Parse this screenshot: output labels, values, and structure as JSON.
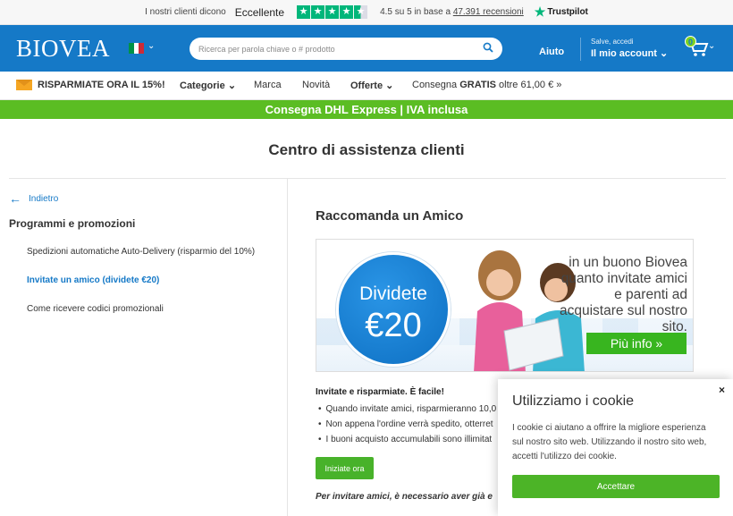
{
  "trustbar": {
    "intro": "I nostri clienti dicono",
    "rating_word": "Eccellente",
    "stars": 4.5,
    "score_text": "4.5 su 5 in base a",
    "reviews_link": "47.391 recensioni",
    "brand": "Trustpilot"
  },
  "header": {
    "logo": "BIOVEA",
    "country_flag": "italy-flag",
    "search_placeholder": "Ricerca per parola chiave o # prodotto",
    "help": "Aiuto",
    "greeting": "Salve, accedi",
    "account": "Il mio account",
    "cart_count": "0"
  },
  "nav": {
    "promo": "RISPARMIATE ORA IL 15%!",
    "categories": "Categorie",
    "brand": "Marca",
    "news": "Novità",
    "offers": "Offerte",
    "shipping_prefix": "Consegna",
    "shipping_bold": "GRATIS",
    "shipping_suffix": "oltre 61,00 € »"
  },
  "greenbar": "Consegna DHL Express | IVA inclusa",
  "page_title": "Centro di assistenza clienti",
  "sidebar": {
    "back": "Indietro",
    "title": "Programmi e promozioni",
    "items": [
      {
        "label": "Spedizioni automatiche Auto-Delivery (risparmio del 10%)",
        "active": false
      },
      {
        "label": "Invitate un amico (dividete €20)",
        "active": true
      },
      {
        "label": "Come ricevere codici promozionali",
        "active": false
      }
    ]
  },
  "main": {
    "title": "Raccomanda un Amico",
    "banner": {
      "circle_line1": "Dividete",
      "circle_line2": "€20",
      "text": "in un buono Biovea quanto invitate amici e parenti ad acquistare sul nostro sito.",
      "button": "Più info »"
    },
    "lead": "Invitate e risparmiate. È facile!",
    "bullets": [
      "Quando invitate amici, risparmieranno 10,0",
      "Non appena l'ordine verrà spedito, otterret",
      "I buoni acquisto accumulabili sono illimitat"
    ],
    "start_button": "Iniziate ora",
    "footnote": "Per invitare amici, è necessario aver già e"
  },
  "cookie": {
    "title": "Utilizziamo i cookie",
    "body": "I cookie ci aiutano a offrire la migliore esperienza sul nostro sito web. Utilizzando il nostro sito web, accetti l'utilizzo dei cookie.",
    "close": "×",
    "accept": "Accettare"
  },
  "colors": {
    "brand_blue": "#1579c7",
    "green": "#5bbd23",
    "trustpilot_green": "#00b67a"
  }
}
